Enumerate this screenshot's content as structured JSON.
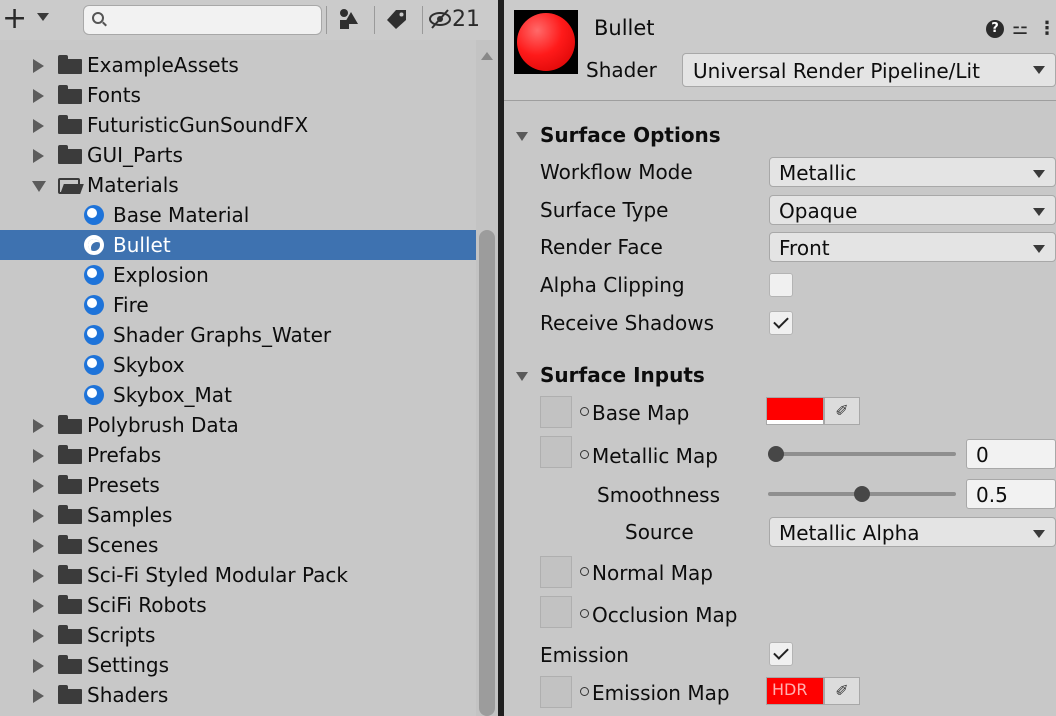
{
  "project_panel": {
    "toolbar": {
      "add_glyph": "+",
      "hidden_count": "21",
      "icons": [
        "plus-icon",
        "dropdown-caret-icon",
        "search-icon",
        "filter-by-type-icon",
        "filter-by-label-icon",
        "hidden-packages-icon"
      ]
    },
    "tree": [
      {
        "label": "ExampleAssets",
        "kind": "folder",
        "expanded": false
      },
      {
        "label": "Fonts",
        "kind": "folder",
        "expanded": false
      },
      {
        "label": "FuturisticGunSoundFX",
        "kind": "folder",
        "expanded": false
      },
      {
        "label": "GUI_Parts",
        "kind": "folder",
        "expanded": false
      },
      {
        "label": "Materials",
        "kind": "folder",
        "expanded": true
      },
      {
        "label": "Base Material",
        "kind": "material"
      },
      {
        "label": "Bullet",
        "kind": "material",
        "selected": true
      },
      {
        "label": "Explosion",
        "kind": "material"
      },
      {
        "label": "Fire",
        "kind": "material"
      },
      {
        "label": "Shader Graphs_Water",
        "kind": "material"
      },
      {
        "label": "Skybox",
        "kind": "material"
      },
      {
        "label": "Skybox_Mat",
        "kind": "material"
      },
      {
        "label": "Polybrush Data",
        "kind": "folder",
        "expanded": false
      },
      {
        "label": "Prefabs",
        "kind": "folder",
        "expanded": false
      },
      {
        "label": "Presets",
        "kind": "folder",
        "expanded": false
      },
      {
        "label": "Samples",
        "kind": "folder",
        "expanded": false
      },
      {
        "label": "Scenes",
        "kind": "folder",
        "expanded": false
      },
      {
        "label": "Sci-Fi Styled Modular Pack",
        "kind": "folder",
        "expanded": false
      },
      {
        "label": "SciFi Robots",
        "kind": "folder",
        "expanded": false
      },
      {
        "label": "Scripts",
        "kind": "folder",
        "expanded": false
      },
      {
        "label": "Settings",
        "kind": "folder",
        "expanded": false
      },
      {
        "label": "Shaders",
        "kind": "folder",
        "expanded": false
      }
    ]
  },
  "inspector": {
    "material_name": "Bullet",
    "shader_label": "Shader",
    "shader_value": "Universal Render Pipeline/Lit",
    "help_glyph": "?",
    "preset_glyph": "⚍",
    "menu_glyph": "⋮",
    "surface_options": {
      "title": "Surface Options",
      "workflow_mode": {
        "label": "Workflow Mode",
        "value": "Metallic"
      },
      "surface_type": {
        "label": "Surface Type",
        "value": "Opaque"
      },
      "render_face": {
        "label": "Render Face",
        "value": "Front"
      },
      "alpha_clipping": {
        "label": "Alpha Clipping",
        "checked": false
      },
      "receive_shadows": {
        "label": "Receive Shadows",
        "checked": true
      }
    },
    "surface_inputs": {
      "title": "Surface Inputs",
      "base_map": {
        "label": "Base Map",
        "color": "#ff0000"
      },
      "metallic_map": {
        "label": "Metallic Map",
        "value": "0",
        "fraction": 0.0
      },
      "smoothness": {
        "label": "Smoothness",
        "value": "0.5",
        "fraction": 0.5
      },
      "source": {
        "label": "Source",
        "value": "Metallic Alpha"
      },
      "normal_map": {
        "label": "Normal Map"
      },
      "occlusion_map": {
        "label": "Occlusion Map"
      },
      "emission": {
        "label": "Emission",
        "checked": true
      },
      "emission_map": {
        "label": "Emission Map",
        "color": "#ff0000",
        "hdr_text": "HDR"
      },
      "eyedropper_glyph": "✐"
    }
  },
  "colors": {
    "selection": "#3e72b0",
    "panel_bg": "#c8c8c8",
    "material_icon": "#1e73d9",
    "divider": "#1f1f1f"
  }
}
